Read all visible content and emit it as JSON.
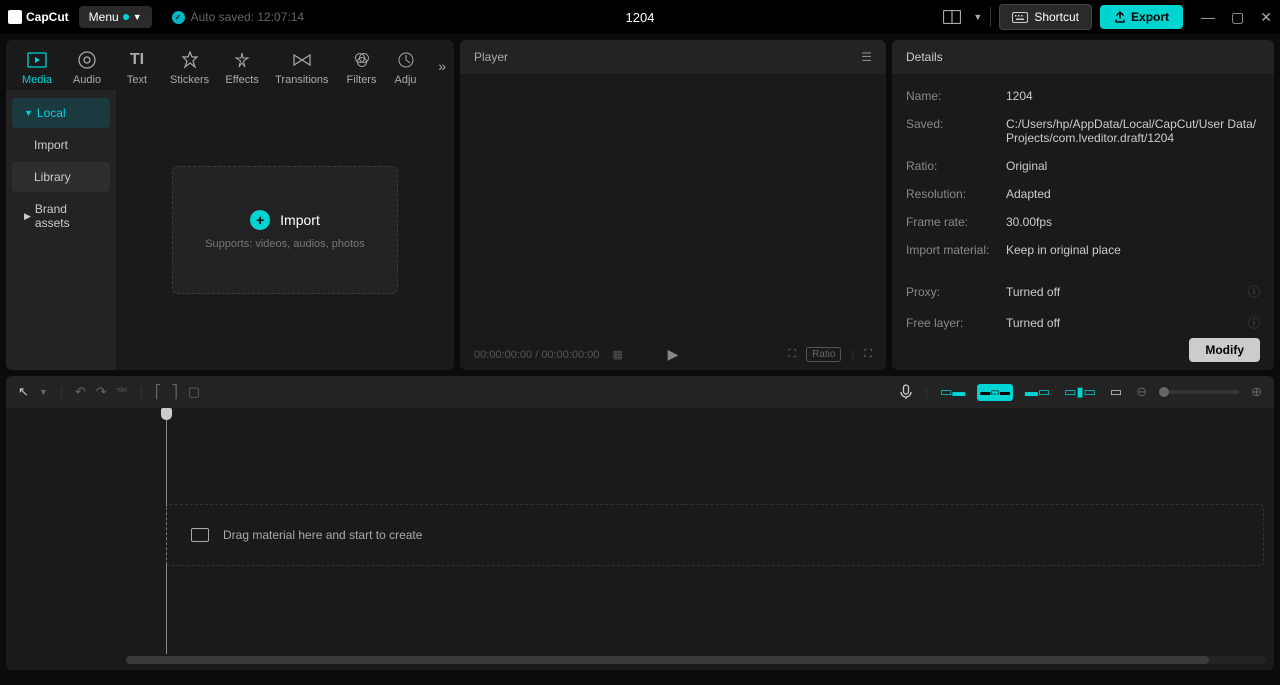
{
  "app": {
    "name": "CapCut"
  },
  "menu_label": "Menu",
  "autosave": "Auto saved: 12:07:14",
  "project_name": "1204",
  "shortcut_label": "Shortcut",
  "export_label": "Export",
  "media_tabs": [
    {
      "label": "Media"
    },
    {
      "label": "Audio"
    },
    {
      "label": "Text"
    },
    {
      "label": "Stickers"
    },
    {
      "label": "Effects"
    },
    {
      "label": "Transitions"
    },
    {
      "label": "Filters"
    },
    {
      "label": "Adju"
    }
  ],
  "media_sidebar": {
    "local": "Local",
    "import": "Import",
    "library": "Library",
    "brand_assets": "Brand assets"
  },
  "import": {
    "label": "Import",
    "sub": "Supports: videos, audios, photos"
  },
  "player": {
    "title": "Player",
    "time_current": "00:00:00:00",
    "time_total": "00:00:00:00",
    "ratio_label": "Ratio"
  },
  "details": {
    "title": "Details",
    "name_label": "Name:",
    "name_value": "1204",
    "saved_label": "Saved:",
    "saved_value": "C:/Users/hp/AppData/Local/CapCut/User Data/Projects/com.lveditor.draft/1204",
    "ratio_label": "Ratio:",
    "ratio_value": "Original",
    "resolution_label": "Resolution:",
    "resolution_value": "Adapted",
    "framerate_label": "Frame rate:",
    "framerate_value": "30.00fps",
    "import_material_label": "Import material:",
    "import_material_value": "Keep in original place",
    "proxy_label": "Proxy:",
    "proxy_value": "Turned off",
    "free_layer_label": "Free layer:",
    "free_layer_value": "Turned off",
    "modify_label": "Modify"
  },
  "timeline": {
    "drop_hint": "Drag material here and start to create"
  }
}
